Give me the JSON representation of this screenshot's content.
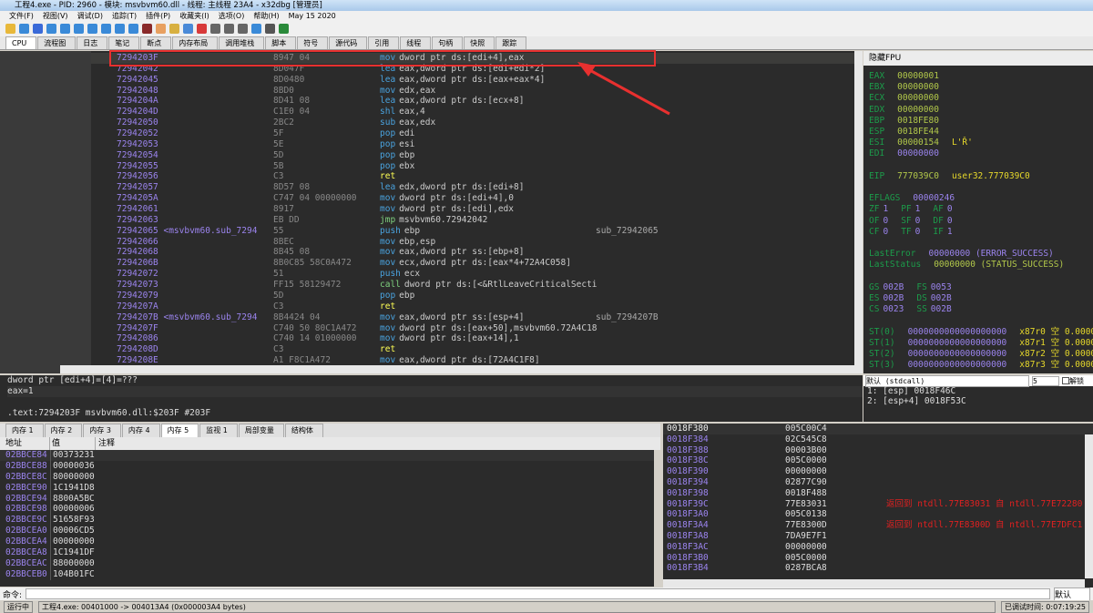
{
  "window": {
    "title": "工程4.exe - PID: 2960 - 模块: msvbvm60.dll - 线程: 主线程 23A4 - x32dbg [管理员]"
  },
  "menu": [
    "文件(F)",
    "视图(V)",
    "调试(D)",
    "追踪(T)",
    "插件(P)",
    "收藏夹(I)",
    "选项(O)",
    "帮助(H)",
    "May 15 2020"
  ],
  "tabs": [
    "CPU",
    "流程图",
    "日志",
    "笔记",
    "断点",
    "内存布局",
    "调用堆栈",
    "脚本",
    "符号",
    "源代码",
    "引用",
    "线程",
    "句柄",
    "快照",
    "跟踪"
  ],
  "disasm": [
    {
      "addr": "7294203F",
      "bytes": "8947 04",
      "m": "mov",
      "ops": "dword ptr ds:[edi+4],eax",
      "cmt": ""
    },
    {
      "addr": "72942042",
      "bytes": "8D047F",
      "m": "lea",
      "ops": "eax,dword ptr ds:[edi+edi*2]",
      "cmt": ""
    },
    {
      "addr": "72942045",
      "bytes": "8D0480",
      "m": "lea",
      "ops": "eax,dword ptr ds:[eax+eax*4]",
      "cmt": ""
    },
    {
      "addr": "72942048",
      "bytes": "8BD0",
      "m": "mov",
      "ops": "edx,eax",
      "cmt": ""
    },
    {
      "addr": "7294204A",
      "bytes": "8D41 08",
      "m": "lea",
      "ops": "eax,dword ptr ds:[ecx+8]",
      "cmt": ""
    },
    {
      "addr": "7294204D",
      "bytes": "C1E0 04",
      "m": "shl",
      "ops": "eax,4",
      "cmt": ""
    },
    {
      "addr": "72942050",
      "bytes": "2BC2",
      "m": "sub",
      "ops": "eax,edx",
      "cmt": ""
    },
    {
      "addr": "72942052",
      "bytes": "5F",
      "m": "pop",
      "ops": "edi",
      "cmt": ""
    },
    {
      "addr": "72942053",
      "bytes": "5E",
      "m": "pop",
      "ops": "esi",
      "cmt": ""
    },
    {
      "addr": "72942054",
      "bytes": "5D",
      "m": "pop",
      "ops": "ebp",
      "cmt": ""
    },
    {
      "addr": "72942055",
      "bytes": "5B",
      "m": "pop",
      "ops": "ebx",
      "cmt": ""
    },
    {
      "addr": "72942056",
      "bytes": "C3",
      "m": "ret",
      "ops": "",
      "cmt": ""
    },
    {
      "addr": "72942057",
      "bytes": "8D57 08",
      "m": "lea",
      "ops": "edx,dword ptr ds:[edi+8]",
      "cmt": ""
    },
    {
      "addr": "7294205A",
      "bytes": "C747 04 00000000",
      "m": "mov",
      "ops": "dword ptr ds:[edi+4],0",
      "cmt": ""
    },
    {
      "addr": "72942061",
      "bytes": "8917",
      "m": "mov",
      "ops": "dword ptr ds:[edi],edx",
      "cmt": ""
    },
    {
      "addr": "72942063",
      "bytes": "EB DD",
      "m": "jmp",
      "ops": "msvbvm60.72942042",
      "cmt": ""
    },
    {
      "addr": "72942065 <msvbvm60.sub_7294",
      "bytes": "55",
      "m": "push",
      "ops": "ebp",
      "cmt": "sub_72942065"
    },
    {
      "addr": "72942066",
      "bytes": "8BEC",
      "m": "mov",
      "ops": "ebp,esp",
      "cmt": ""
    },
    {
      "addr": "72942068",
      "bytes": "8B45 08",
      "m": "mov",
      "ops": "eax,dword ptr ss:[ebp+8]",
      "cmt": ""
    },
    {
      "addr": "7294206B",
      "bytes": "8B0C85 58C0A472",
      "m": "mov",
      "ops": "ecx,dword ptr ds:[eax*4+72A4C058]",
      "cmt": ""
    },
    {
      "addr": "72942072",
      "bytes": "51",
      "m": "push",
      "ops": "ecx",
      "cmt": ""
    },
    {
      "addr": "72942073",
      "bytes": "FF15 58129472",
      "m": "call",
      "ops": "dword ptr ds:[<&RtlLeaveCriticalSecti",
      "cmt": ""
    },
    {
      "addr": "72942079",
      "bytes": "5D",
      "m": "pop",
      "ops": "ebp",
      "cmt": ""
    },
    {
      "addr": "7294207A",
      "bytes": "C3",
      "m": "ret",
      "ops": "",
      "cmt": ""
    },
    {
      "addr": "7294207B <msvbvm60.sub_7294",
      "bytes": "8B4424 04",
      "m": "mov",
      "ops": "eax,dword ptr ss:[esp+4]",
      "cmt": "sub_7294207B"
    },
    {
      "addr": "7294207F",
      "bytes": "C740 50 80C1A472",
      "m": "mov",
      "ops": "dword ptr ds:[eax+50],msvbvm60.72A4C18",
      "cmt": ""
    },
    {
      "addr": "72942086",
      "bytes": "C740 14 01000000",
      "m": "mov",
      "ops": "dword ptr ds:[eax+14],1",
      "cmt": ""
    },
    {
      "addr": "7294208D",
      "bytes": "C3",
      "m": "ret",
      "ops": "",
      "cmt": ""
    },
    {
      "addr": "7294208E",
      "bytes": "A1 F8C1A472",
      "m": "mov",
      "ops": "eax,dword ptr ds:[72A4C1F8]",
      "cmt": ""
    }
  ],
  "registers": {
    "header": "隐藏FPU",
    "lines": [
      [
        [
          "EAX",
          "rn"
        ],
        [
          "00000001",
          "rv"
        ]
      ],
      [
        [
          "EBX",
          "rn"
        ],
        [
          "00000000",
          "rv"
        ]
      ],
      [
        [
          "ECX",
          "rn"
        ],
        [
          "00000000",
          "rv"
        ]
      ],
      [
        [
          "EDX",
          "rn"
        ],
        [
          "00000000",
          "rv"
        ]
      ],
      [
        [
          "EBP",
          "rn"
        ],
        [
          "0018FE80",
          "rv"
        ]
      ],
      [
        [
          "ESP",
          "rn"
        ],
        [
          "0018FE44",
          "rv"
        ]
      ],
      [
        [
          "ESI",
          "rn"
        ],
        [
          "00000154",
          "rv"
        ],
        [
          "L'Ř'",
          "ry"
        ]
      ],
      [
        [
          "EDI",
          "rn"
        ],
        [
          "00000000",
          "rp"
        ]
      ],
      [],
      [
        [
          "EIP",
          "rn"
        ],
        [
          "777039C0",
          "rv"
        ],
        [
          "user32.777039C0",
          "ry"
        ]
      ],
      [],
      [
        [
          "EFLAGS",
          "rn"
        ],
        [
          "00000246",
          "rp"
        ]
      ],
      [
        [
          "ZF",
          "rn"
        ],
        [
          "1",
          "rp"
        ],
        [
          "PF",
          "rn"
        ],
        [
          "1",
          "rp"
        ],
        [
          "AF",
          "rn"
        ],
        [
          "0",
          "rp"
        ]
      ],
      [
        [
          "OF",
          "rn"
        ],
        [
          "0",
          "rp"
        ],
        [
          "SF",
          "rn"
        ],
        [
          "0",
          "rp"
        ],
        [
          "DF",
          "rn"
        ],
        [
          "0",
          "rp"
        ]
      ],
      [
        [
          "CF",
          "rn"
        ],
        [
          "0",
          "rp"
        ],
        [
          "TF",
          "rn"
        ],
        [
          "0",
          "rp"
        ],
        [
          "IF",
          "rn"
        ],
        [
          "1",
          "rp"
        ]
      ],
      [],
      [
        [
          "LastError",
          "rn"
        ],
        [
          "00000000 (ERROR_SUCCESS)",
          "rp"
        ]
      ],
      [
        [
          "LastStatus",
          "rn"
        ],
        [
          "00000000 (STATUS_SUCCESS)",
          "rv"
        ]
      ],
      [],
      [
        [
          "GS",
          "rn"
        ],
        [
          "002B",
          "rp"
        ],
        [
          "FS",
          "rn"
        ],
        [
          "0053",
          "rp"
        ]
      ],
      [
        [
          "ES",
          "rn"
        ],
        [
          "002B",
          "rp"
        ],
        [
          "DS",
          "rn"
        ],
        [
          "002B",
          "rp"
        ]
      ],
      [
        [
          "CS",
          "rn"
        ],
        [
          "0023",
          "rp"
        ],
        [
          "SS",
          "rn"
        ],
        [
          "002B",
          "rp"
        ]
      ],
      [],
      [
        [
          "ST(0)",
          "rn"
        ],
        [
          "0000000000000000000",
          "rp"
        ],
        [
          "x87r0 空 0.00000",
          "ry"
        ]
      ],
      [
        [
          "ST(1)",
          "rn"
        ],
        [
          "0000000000000000000",
          "rp"
        ],
        [
          "x87r1 空 0.00000",
          "ry"
        ]
      ],
      [
        [
          "ST(2)",
          "rn"
        ],
        [
          "0000000000000000000",
          "rp"
        ],
        [
          "x87r2 空 0.00000",
          "ry"
        ]
      ],
      [
        [
          "ST(3)",
          "rn"
        ],
        [
          "0000000000000000000",
          "rp"
        ],
        [
          "x87r3 空 0.00000",
          "ry"
        ]
      ]
    ]
  },
  "info": {
    "line1": "dword ptr [edi+4]=[4]=???",
    "line2": "eax=1",
    "line3": ".text:7294203F msvbvm60.dll:$203F #203F"
  },
  "callstack": {
    "convention": "默认 (stdcall)",
    "count": "5",
    "unlock_label": "解锁",
    "items": [
      "1: [esp] 0018F46C",
      "2: [esp+4] 0018F53C"
    ]
  },
  "memtabs": [
    "内存 1",
    "内存 2",
    "内存 3",
    "内存 4",
    "内存 5",
    "监视 1",
    "局部变量",
    "结构体"
  ],
  "memhdr": {
    "addr": "地址",
    "value": "值",
    "comment": "注释"
  },
  "memory": [
    [
      "02BBCE84",
      "00373231"
    ],
    [
      "02BBCE88",
      "00000036"
    ],
    [
      "02BBCE8C",
      "80000000"
    ],
    [
      "02BBCE90",
      "1C1941D8"
    ],
    [
      "02BBCE94",
      "8800A5BC"
    ],
    [
      "02BBCE98",
      "00000006"
    ],
    [
      "02BBCE9C",
      "51658F93"
    ],
    [
      "02BBCEA0",
      "00006CD5"
    ],
    [
      "02BBCEA4",
      "00000000"
    ],
    [
      "02BBCEA8",
      "1C1941DF"
    ],
    [
      "02BBCEAC",
      "88000000"
    ],
    [
      "02BBCEB0",
      "104B01FC"
    ]
  ],
  "stack": [
    [
      "0018F380",
      "005C00C4",
      ""
    ],
    [
      "0018F384",
      "02C545C8",
      ""
    ],
    [
      "0018F388",
      "00003B00",
      ""
    ],
    [
      "0018F38C",
      "005C0000",
      ""
    ],
    [
      "0018F390",
      "00000000",
      ""
    ],
    [
      "0018F394",
      "02877C90",
      ""
    ],
    [
      "0018F398",
      "0018F488",
      ""
    ],
    [
      "0018F39C",
      "77E83031",
      "返回到 ntdll.77E83031 自 ntdll.77E72280"
    ],
    [
      "0018F3A0",
      "005C0138",
      ""
    ],
    [
      "0018F3A4",
      "77E8300D",
      "返回到 ntdll.77E8300D 自 ntdll.77E7DFC1"
    ],
    [
      "0018F3A8",
      "7DA9E7F1",
      ""
    ],
    [
      "0018F3AC",
      "00000000",
      ""
    ],
    [
      "0018F3B0",
      "005C0000",
      ""
    ],
    [
      "0018F3B4",
      "0287BCA8",
      ""
    ]
  ],
  "command": {
    "label": "命令:",
    "mode": "默认"
  },
  "status": {
    "state": "运行中",
    "module": "工程4.exe: 00401000 -> 004013A4 (0x000003A4 bytes)",
    "time": "已调试时间: 0:07:19:25"
  },
  "colors": {
    "highlight": "#e8302f",
    "background": "#2b2b2b",
    "address": "#9b84ee"
  }
}
